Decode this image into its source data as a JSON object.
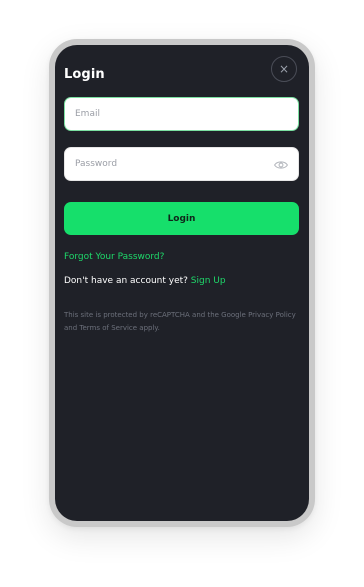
{
  "modal": {
    "title": "Login",
    "close_symbol": "×"
  },
  "email": {
    "placeholder": "Email",
    "value": ""
  },
  "password": {
    "placeholder": "Password",
    "value": "",
    "toggle_icon": "eye-icon"
  },
  "login_button": {
    "label": "Login"
  },
  "forgot_link": {
    "label": "Forgot Your Password?"
  },
  "signup": {
    "prompt": "Don't have an account yet?",
    "link": "Sign Up"
  },
  "legal": {
    "text": "This site is protected by reCAPTCHA and the Google Privacy Policy and Terms of Service apply."
  },
  "colors": {
    "accent": "#16df6b",
    "link": "#1ed86a",
    "background": "#1f2128",
    "frame": "#c9c9c9"
  }
}
